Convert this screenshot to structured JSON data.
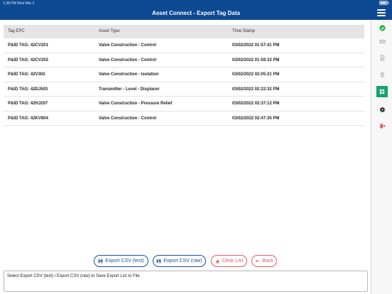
{
  "status_bar": {
    "time": "1:38 PM   Wed Mar 2"
  },
  "header": {
    "title": "Asset Connect - Export Tag Data"
  },
  "rail": {
    "icons": [
      "check-circle-icon",
      "barcode-icon",
      "document-icon",
      "location-pin-icon",
      "grid-icon",
      "gear-icon",
      "logout-icon"
    ],
    "active": "grid-icon"
  },
  "table": {
    "columns": [
      "Tag EPC",
      "Asset Type",
      "Time Stamp"
    ],
    "rows": [
      {
        "tag": "P&ID TAG: 42CV201",
        "type": "Valve Construction - Control",
        "time": "03/02/2022 01:57:41 PM"
      },
      {
        "tag": "P&ID TAG: 42CV202",
        "type": "Valve Construction - Control",
        "time": "03/02/2022 01:59:33 PM"
      },
      {
        "tag": "P&ID TAG: 42V302",
        "type": "Valve Construction - Isolation",
        "time": "03/02/2022 02:05:21 PM"
      },
      {
        "tag": "P&ID TAG: 42DJ503",
        "type": "Transmitter - Level - Displacer",
        "time": "03/02/2022 02:22:32 PM"
      },
      {
        "tag": "P&ID TAG: 42HJ207",
        "type": "Valve Construction - Pressure Relief",
        "time": "03/02/2022 02:37:12 PM"
      },
      {
        "tag": "P&ID TAG: 42KV804",
        "type": "Valve Construction - Control",
        "time": "03/02/2022 02:47:35 PM"
      }
    ]
  },
  "actions": {
    "export_csv_text": "Export CSV (text)",
    "export_csv_raw": "Export CSV (raw)",
    "clear_list": "Clear List",
    "back": "Back"
  },
  "message": "Select Export CSV (text) / Export CSV (raw) to Save Export List to File",
  "colors": {
    "header": "#0d4a93",
    "accent": "#1c4f96",
    "danger": "#e25a66",
    "active_rail": "#13a36c"
  }
}
